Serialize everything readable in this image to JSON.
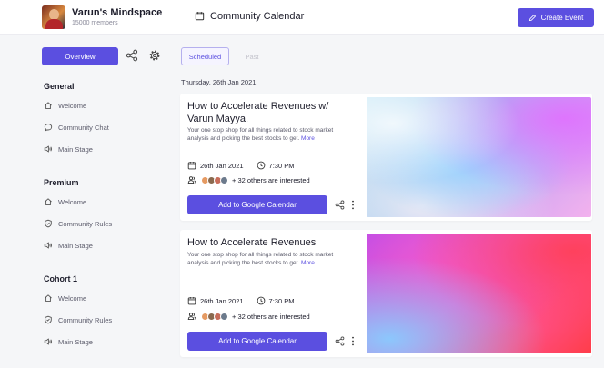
{
  "header": {
    "community_name": "Varun's Mindspace",
    "member_count": "15000 members",
    "page_title": "Community Calendar",
    "create_event_label": "Create Event"
  },
  "sidebar": {
    "overview_label": "Overview",
    "sections": [
      {
        "title": "General",
        "items": [
          {
            "label": "Welcome",
            "icon": "home-icon"
          },
          {
            "label": "Community Chat",
            "icon": "chat-icon"
          },
          {
            "label": "Main Stage",
            "icon": "speaker-icon"
          }
        ]
      },
      {
        "title": "Premium",
        "items": [
          {
            "label": "Welcome",
            "icon": "home-icon"
          },
          {
            "label": "Community Rules",
            "icon": "shield-icon"
          },
          {
            "label": "Main Stage",
            "icon": "speaker-icon"
          }
        ]
      },
      {
        "title": "Cohort 1",
        "items": [
          {
            "label": "Welcome",
            "icon": "home-icon"
          },
          {
            "label": "Community Rules",
            "icon": "shield-icon"
          },
          {
            "label": "Main Stage",
            "icon": "speaker-icon"
          }
        ]
      }
    ]
  },
  "main": {
    "tabs": [
      {
        "label": "Scheduled",
        "active": true
      },
      {
        "label": "Past",
        "active": false
      }
    ],
    "date_heading": "Thursday, 26th Jan 2021",
    "events": [
      {
        "title": "How to Accelerate Revenues w/ Varun Mayya.",
        "description": "Your one stop shop for all things related to stock market analysis and picking the best stocks to get.",
        "more_label": "More",
        "date": "26th Jan 2021",
        "time": "7:30 PM",
        "interested": "+ 32 others are interested",
        "button_label": "Add to Google Calendar"
      },
      {
        "title": "How to Accelerate Revenues",
        "description": "Your one stop shop for all things related to stock market analysis and picking the best stocks to get.",
        "more_label": "More",
        "date": "26th Jan 2021",
        "time": "7:30 PM",
        "interested": "+ 32 others are interested",
        "button_label": "Add to Google Calendar"
      }
    ]
  },
  "colors": {
    "accent": "#5b4fe0",
    "background": "#f5f6f8"
  }
}
